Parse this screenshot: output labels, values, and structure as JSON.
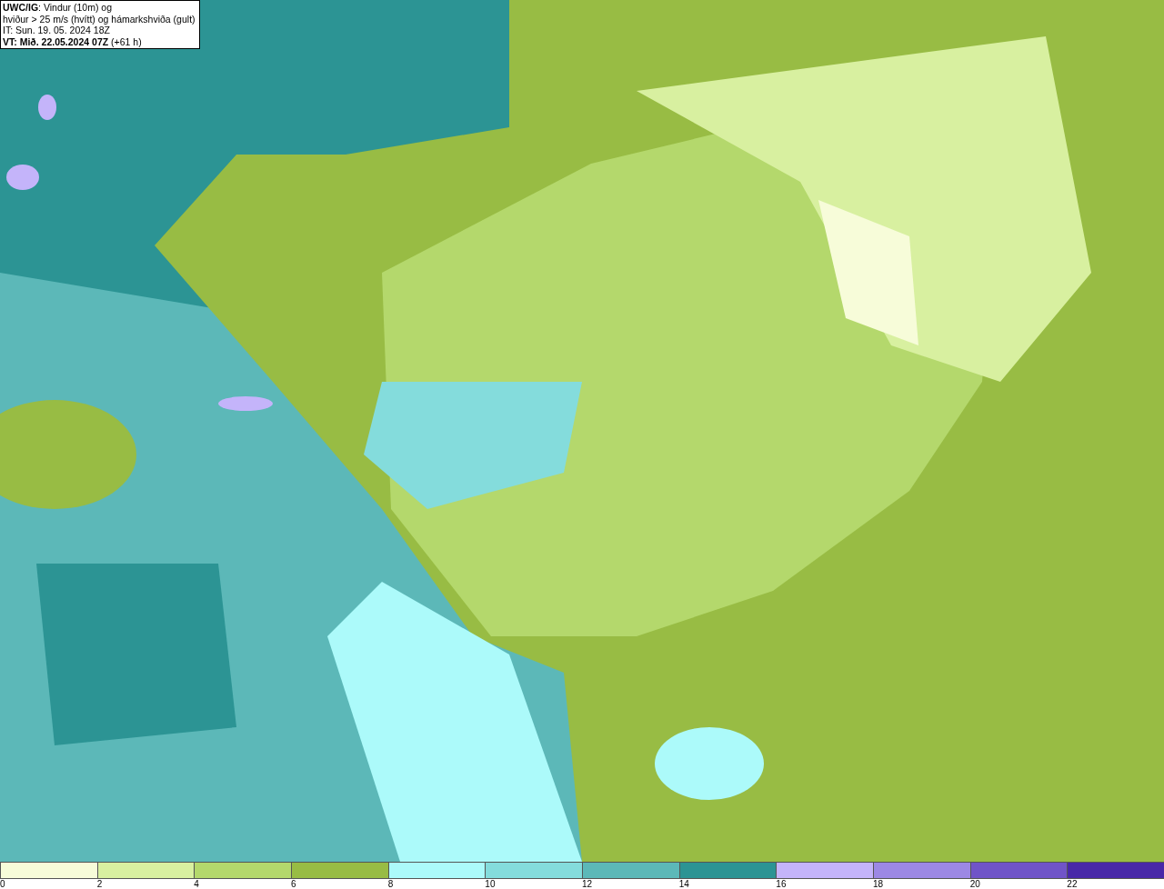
{
  "info_box": {
    "lines": [
      "**UWC/IG**: Vindur (10m) og",
      "hviður > 25 m/s (hvítt) og hámarkshviða (gult)",
      "IT: Sun. 19. 05. 2024 18Z",
      "**VT: Mið. 22.05.2024 07Z** (+61 h)"
    ]
  },
  "legend": {
    "bins": [
      {
        "label": "0",
        "color": "#f7fcd9"
      },
      {
        "label": "2",
        "color": "#d8f0a0"
      },
      {
        "label": "4",
        "color": "#b4d86c"
      },
      {
        "label": "6",
        "color": "#98bc44"
      },
      {
        "label": "8",
        "color": "#acfafa"
      },
      {
        "label": "10",
        "color": "#84dcdc"
      },
      {
        "label": "12",
        "color": "#5cb8b8"
      },
      {
        "label": "14",
        "color": "#2c9494"
      },
      {
        "label": "16",
        "color": "#c4b4fa"
      },
      {
        "label": "18",
        "color": "#9c88e4"
      },
      {
        "label": "20",
        "color": "#7054c8"
      },
      {
        "label": "22",
        "color": "#4828a8"
      }
    ]
  }
}
